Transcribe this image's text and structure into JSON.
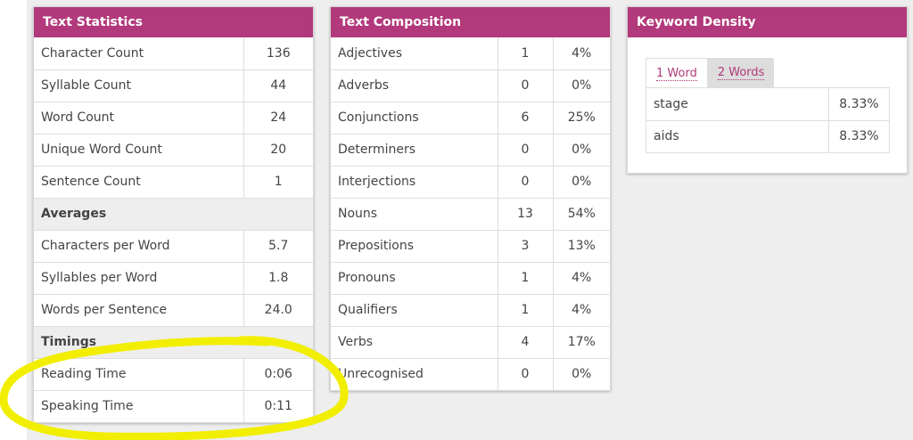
{
  "text_statistics": {
    "title": "Text Statistics",
    "rows": [
      {
        "label": "Character Count",
        "value": "136"
      },
      {
        "label": "Syllable Count",
        "value": "44"
      },
      {
        "label": "Word Count",
        "value": "24"
      },
      {
        "label": "Unique Word Count",
        "value": "20"
      },
      {
        "label": "Sentence Count",
        "value": "1"
      }
    ],
    "averages_label": "Averages",
    "averages": [
      {
        "label": "Characters per Word",
        "value": "5.7"
      },
      {
        "label": "Syllables per Word",
        "value": "1.8"
      },
      {
        "label": "Words per Sentence",
        "value": "24.0"
      }
    ],
    "timings_label": "Timings",
    "timings": [
      {
        "label": "Reading Time",
        "value": "0:06"
      },
      {
        "label": "Speaking Time",
        "value": "0:11"
      }
    ]
  },
  "text_composition": {
    "title": "Text Composition",
    "rows": [
      {
        "label": "Adjectives",
        "count": "1",
        "percent": "4%"
      },
      {
        "label": "Adverbs",
        "count": "0",
        "percent": "0%"
      },
      {
        "label": "Conjunctions",
        "count": "6",
        "percent": "25%"
      },
      {
        "label": "Determiners",
        "count": "0",
        "percent": "0%"
      },
      {
        "label": "Interjections",
        "count": "0",
        "percent": "0%"
      },
      {
        "label": "Nouns",
        "count": "13",
        "percent": "54%"
      },
      {
        "label": "Prepositions",
        "count": "3",
        "percent": "13%"
      },
      {
        "label": "Pronouns",
        "count": "1",
        "percent": "4%"
      },
      {
        "label": "Qualifiers",
        "count": "1",
        "percent": "4%"
      },
      {
        "label": "Verbs",
        "count": "4",
        "percent": "17%"
      },
      {
        "label": "Unrecognised",
        "count": "0",
        "percent": "0%"
      }
    ]
  },
  "keyword_density": {
    "title": "Keyword Density",
    "tabs": [
      {
        "label": "1 Word",
        "active": true
      },
      {
        "label": "2 Words",
        "active": false
      }
    ],
    "rows": [
      {
        "keyword": "stage",
        "density": "8.33%"
      },
      {
        "keyword": "aids",
        "density": "8.33%"
      }
    ]
  },
  "colors": {
    "accent": "#b2397b",
    "highlight": "#f2ee00"
  }
}
